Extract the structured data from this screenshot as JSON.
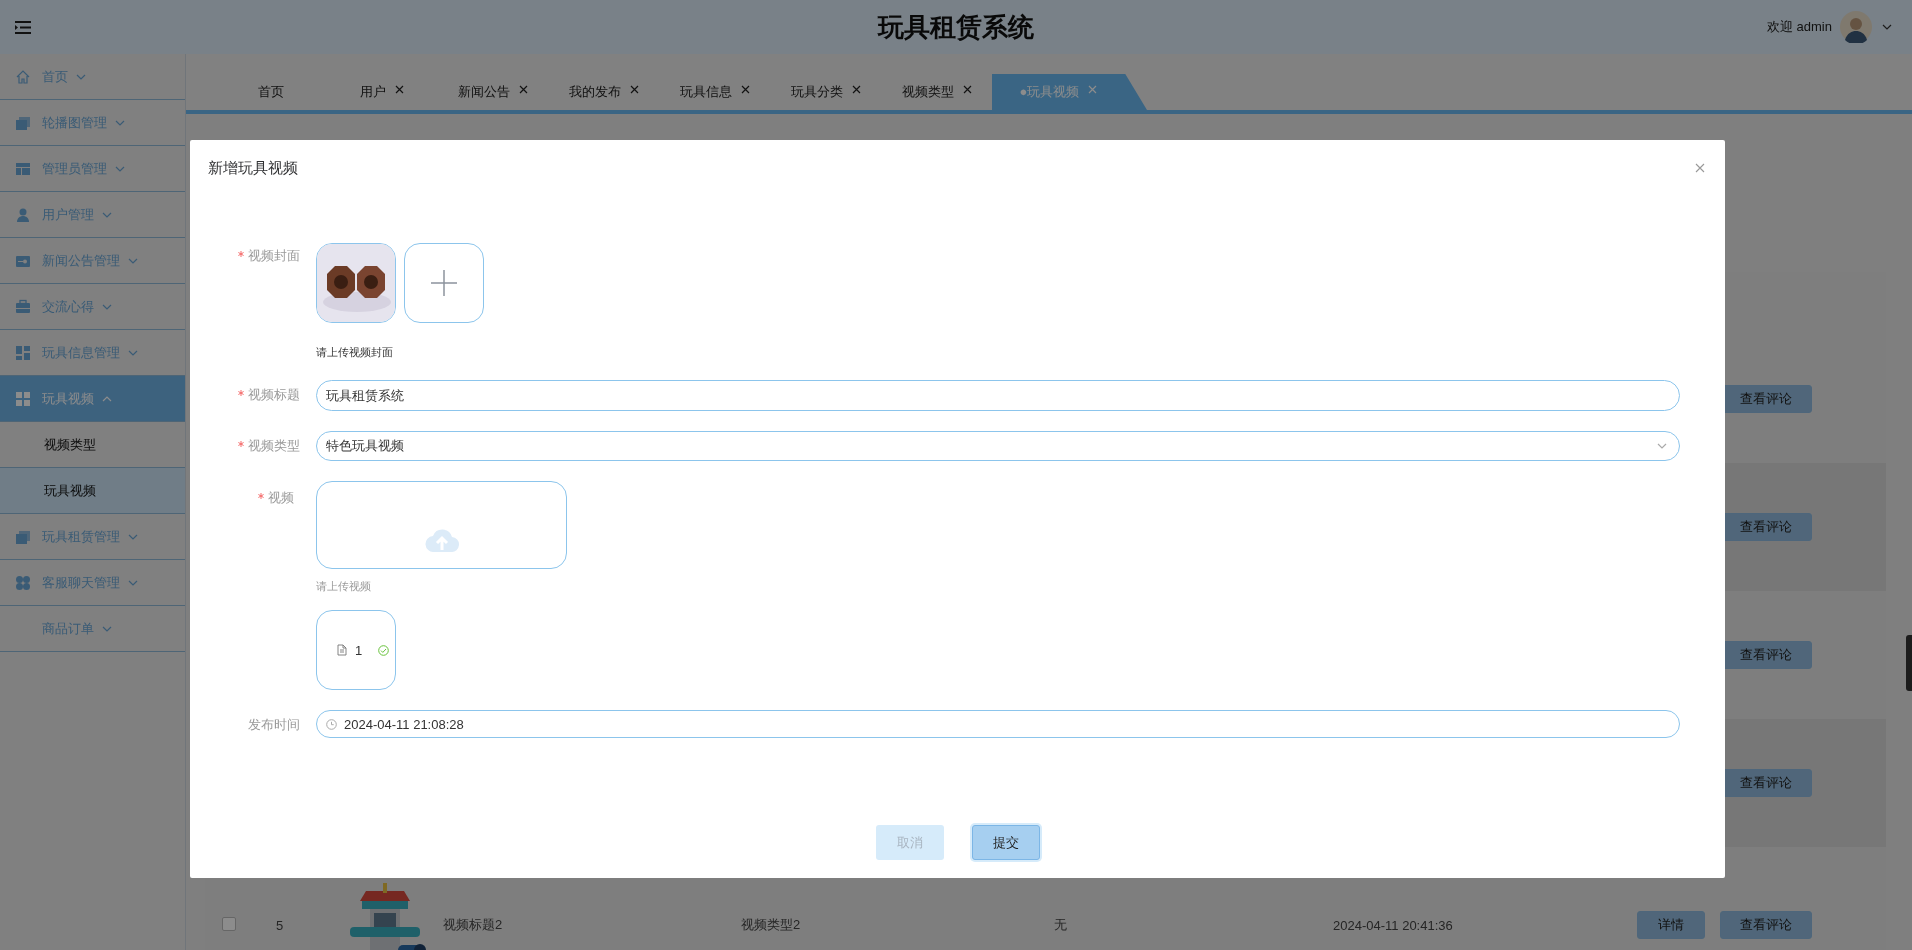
{
  "header": {
    "title": "玩具租赁系统",
    "welcome": "欢迎 admin"
  },
  "sidebar": {
    "items": [
      {
        "label": "首页",
        "expanded": false,
        "selected": false
      },
      {
        "label": "轮播图管理",
        "expanded": false,
        "selected": false
      },
      {
        "label": "管理员管理",
        "expanded": false,
        "selected": false
      },
      {
        "label": "用户管理",
        "expanded": false,
        "selected": false
      },
      {
        "label": "新闻公告管理",
        "expanded": false,
        "selected": false
      },
      {
        "label": "交流心得",
        "expanded": false,
        "selected": false
      },
      {
        "label": "玩具信息管理",
        "expanded": false,
        "selected": false
      },
      {
        "label": "玩具视频",
        "expanded": true,
        "selected": true,
        "children": [
          {
            "label": "视频类型",
            "selected": false
          },
          {
            "label": "玩具视频",
            "selected": true
          }
        ]
      },
      {
        "label": "玩具租赁管理",
        "expanded": false,
        "selected": false
      },
      {
        "label": "客服聊天管理",
        "expanded": false,
        "selected": false
      },
      {
        "label": "商品订单",
        "expanded": false,
        "selected": false
      }
    ]
  },
  "tabs": [
    {
      "label": "首页",
      "closable": false,
      "selected": false
    },
    {
      "label": "用户",
      "closable": true,
      "selected": false
    },
    {
      "label": "新闻公告",
      "closable": true,
      "selected": false
    },
    {
      "label": "我的发布",
      "closable": true,
      "selected": false
    },
    {
      "label": "玩具信息",
      "closable": true,
      "selected": false
    },
    {
      "label": "玩具分类",
      "closable": true,
      "selected": false
    },
    {
      "label": "视频类型",
      "closable": true,
      "selected": false
    },
    {
      "label": "●玩具视频",
      "closable": true,
      "selected": true
    }
  ],
  "table": {
    "rows": [
      {
        "actions": [
          "查看评论"
        ]
      },
      {
        "actions": [
          "查看评论"
        ]
      },
      {
        "actions": [
          "查看评论"
        ]
      },
      {
        "actions": [
          "查看评论"
        ]
      },
      {
        "checked": false,
        "cells": [
          "5",
          "视频标题2",
          "视频类型2",
          "无",
          "2024-04-11 20:41:36"
        ],
        "actions": [
          "详情",
          "查看评论"
        ]
      }
    ]
  },
  "dialog": {
    "title": "新增玩具视频",
    "fields": [
      {
        "kind": "image_upload",
        "label": "视频封面",
        "required": true,
        "hint": "请上传视频封面"
      },
      {
        "kind": "text",
        "label": "视频标题",
        "required": true,
        "value": "玩具租赁系统"
      },
      {
        "kind": "select",
        "label": "视频类型",
        "required": true,
        "value": "特色玩具视频"
      },
      {
        "kind": "file_upload",
        "label": "视频",
        "required": true,
        "hint": "请上传视频",
        "files": [
          {
            "name": "1",
            "uploaded": true
          }
        ]
      },
      {
        "kind": "date",
        "label": "发布时间",
        "required": false,
        "value": "2024-04-11 21:08:28"
      }
    ],
    "buttons": [
      {
        "label": "取消",
        "kind": "cancel"
      },
      {
        "label": "提交",
        "kind": "primary"
      }
    ]
  }
}
